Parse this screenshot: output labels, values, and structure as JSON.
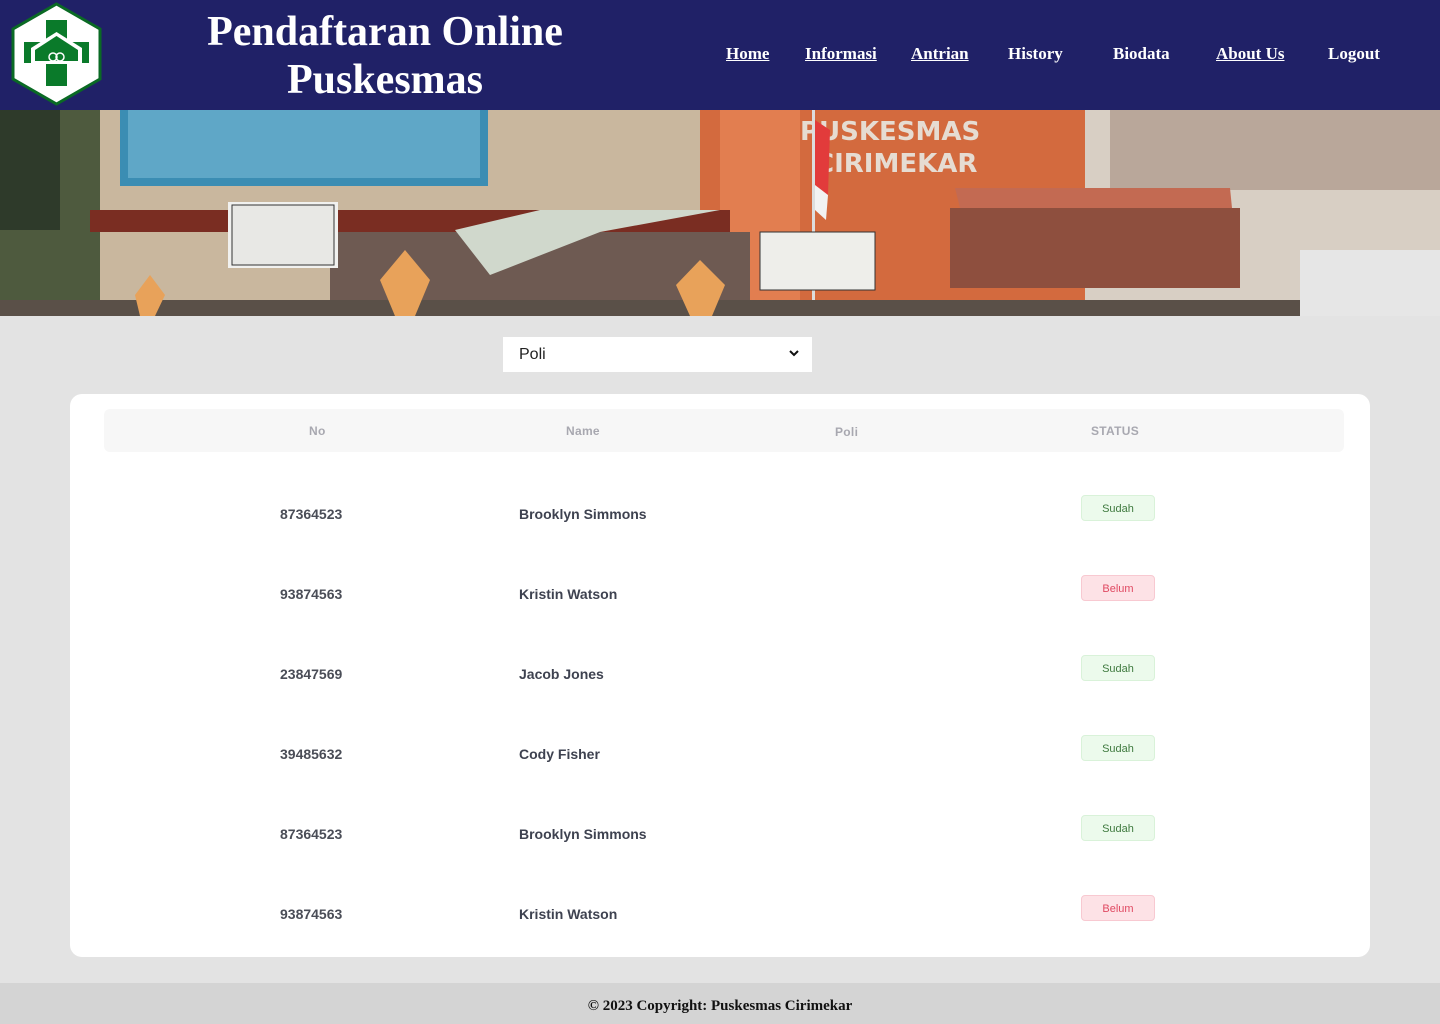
{
  "header": {
    "title_line1": "Pendaftaran Online",
    "title_line2": "Puskesmas",
    "logo_icon": "puskesmas-logo-icon",
    "nav": [
      {
        "label": "Home"
      },
      {
        "label": "Informasi"
      },
      {
        "label": "Antrian"
      },
      {
        "label": "History"
      },
      {
        "label": "Biodata"
      },
      {
        "label": "About Us"
      },
      {
        "label": "Logout"
      }
    ]
  },
  "hero": {
    "sign_line1": "PUSKESMAS",
    "sign_line2": "CIRIMEKAR"
  },
  "filter": {
    "selected": "Poli",
    "icon": "chevron-down-icon"
  },
  "table": {
    "columns": [
      "No",
      "Name",
      "Poli",
      "STATUS"
    ],
    "rows": [
      {
        "no": "87364523",
        "name": "Brooklyn Simmons",
        "poli": "",
        "status": "Sudah"
      },
      {
        "no": "93874563",
        "name": "Kristin Watson",
        "poli": "",
        "status": "Belum"
      },
      {
        "no": "23847569",
        "name": "Jacob Jones",
        "poli": "",
        "status": "Sudah"
      },
      {
        "no": "39485632",
        "name": "Cody Fisher",
        "poli": "",
        "status": "Sudah"
      },
      {
        "no": "87364523",
        "name": "Brooklyn Simmons",
        "poli": "",
        "status": "Sudah"
      },
      {
        "no": "93874563",
        "name": "Kristin Watson",
        "poli": "",
        "status": "Belum"
      }
    ]
  },
  "footer": {
    "copyright": "© 2023 Copyright: Puskesmas Cirimekar"
  },
  "colors": {
    "header_bg": "#202167",
    "status_done": "#3f7a3f",
    "status_pending": "#e04a62",
    "logo_green": "#0a7a2a"
  }
}
